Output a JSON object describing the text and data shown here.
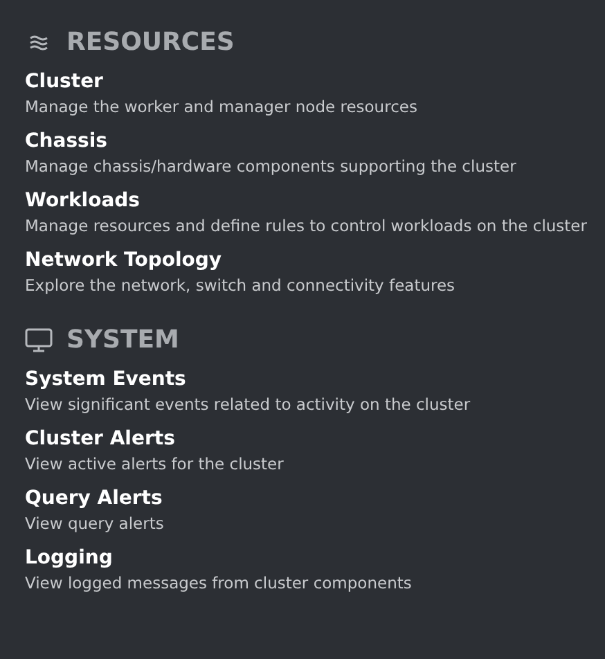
{
  "sections": [
    {
      "title": "RESOURCES",
      "kind": "resources",
      "items": [
        {
          "title": "Cluster",
          "description": "Manage the worker and manager node resources"
        },
        {
          "title": "Chassis",
          "description": "Manage chassis/hardware components supporting the cluster"
        },
        {
          "title": "Workloads",
          "description": "Manage resources and define rules to control workloads on the cluster"
        },
        {
          "title": "Network Topology",
          "description": "Explore the network, switch and connectivity features"
        }
      ]
    },
    {
      "title": "SYSTEM",
      "kind": "system",
      "items": [
        {
          "title": "System Events",
          "description": "View significant events related to activity on the cluster"
        },
        {
          "title": "Cluster Alerts",
          "description": "View active alerts for the cluster"
        },
        {
          "title": "Query Alerts",
          "description": "View query alerts"
        },
        {
          "title": "Logging",
          "description": "View logged messages from cluster components"
        }
      ]
    }
  ]
}
